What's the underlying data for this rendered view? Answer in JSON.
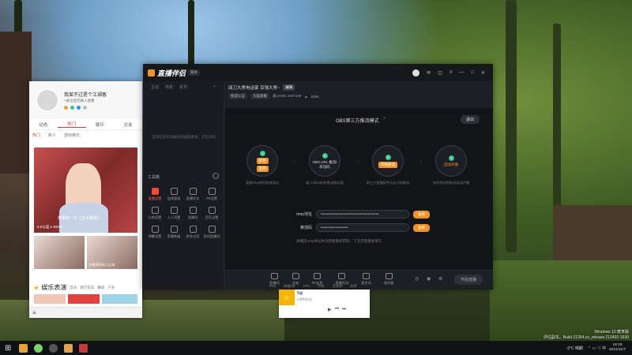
{
  "social": {
    "name": "我某不过是个江湖客",
    "sub": "+关注后可被人查看",
    "tabs": [
      "动态",
      "热门",
      "娱乐",
      "交友"
    ],
    "active_tab": "热门",
    "subtabs": [
      "热门",
      "新人",
      "游戏娱乐"
    ],
    "feature_caption": "象朝凯一万《王大歌星》",
    "feature_meta": "5.5公里   ♦ 38353",
    "thumb_caption": "主播漂亮的人立体",
    "section_title": "娱乐表演",
    "section_tabs": [
      "音乐",
      "旅行花车",
      "舞蹈",
      "户外"
    ]
  },
  "app": {
    "logo": "直播伴侣",
    "logo_badge": "版本",
    "left_tabs": [
      "互动",
      "场景",
      "素材"
    ],
    "left_empty": "当前还没有添加任何画面素材，点击添加",
    "tools_title": "工具箱",
    "tools": [
      {
        "label": "直播设置",
        "icon": "record-icon",
        "active": true
      },
      {
        "label": "连线管理",
        "icon": "user-icon",
        "active": false
      },
      {
        "label": "直播任务",
        "icon": "task-icon",
        "active": false
      },
      {
        "label": "PK设置",
        "icon": "pk-icon",
        "active": false
      },
      {
        "label": "礼物设置",
        "icon": "gift-icon",
        "active": false
      },
      {
        "label": "入人设置",
        "icon": "download-icon",
        "active": false
      },
      {
        "label": "直播间",
        "icon": "room-icon",
        "active": false
      },
      {
        "label": "音乐设置",
        "icon": "music-icon",
        "active": false
      },
      {
        "label": "弹幕设置",
        "icon": "danmu-icon",
        "active": false
      },
      {
        "label": "直播数据",
        "icon": "data-icon",
        "active": false
      },
      {
        "label": "更多应用",
        "icon": "more-icon",
        "active": false
      },
      {
        "label": "我的直播间",
        "icon": "home-icon",
        "active": false
      }
    ],
    "room_title": "阔刀大男电话家 百强大男~",
    "room_tag": "编辑",
    "room_chips": [
      "频道认证",
      "天猫旗舰"
    ],
    "room_meta": "喜UANG 2597188",
    "room_fans": "5086",
    "obs_title": "OBS第三方推流模式",
    "exit_label": "退出",
    "steps": [
      {
        "num": "1",
        "pill": "复制",
        "text": "",
        "desc": "复制rtmp地址和推流码"
      },
      {
        "num": "2",
        "pill": "",
        "text": "OBS URL 推流/串流码",
        "desc": "填入OBS串流/推流服务器"
      },
      {
        "num": "3",
        "pill": "开始推流",
        "text": "",
        "desc": "第三方直播软件点击开始推流"
      },
      {
        "num": "4",
        "pill": "",
        "text": "自动开播",
        "desc": "伴侣检测到推流自动开播"
      }
    ],
    "rtmp_label": "rtmp地址",
    "rtmp_value": "••••••••••••••••••••••••••••••••••••",
    "key_label": "推流码",
    "key_value": "•••••••••••••••••",
    "copy_label": "复制",
    "hint": "关播后rtmp地址失效需要重新获取，下次无需重复填写",
    "bottom_tools": [
      "直播间",
      "连麦",
      "PK连麦",
      "直播任务",
      "麦克风",
      "扬声器"
    ],
    "start_label": "开始直播",
    "status": [
      "FPS",
      "网络OK",
      "CPU",
      "内存",
      "丢帧率",
      "码率"
    ]
  },
  "music": {
    "title": "Ngi",
    "sub": "23时25分"
  },
  "watermark": {
    "line1": "Windows 10 教育版",
    "line2": "评估副本。Build 21354.co_release.210402-1630"
  },
  "taskbar": {
    "weather": "-3°C 晴朗",
    "time": "19:18",
    "date": "2021/11/7"
  }
}
